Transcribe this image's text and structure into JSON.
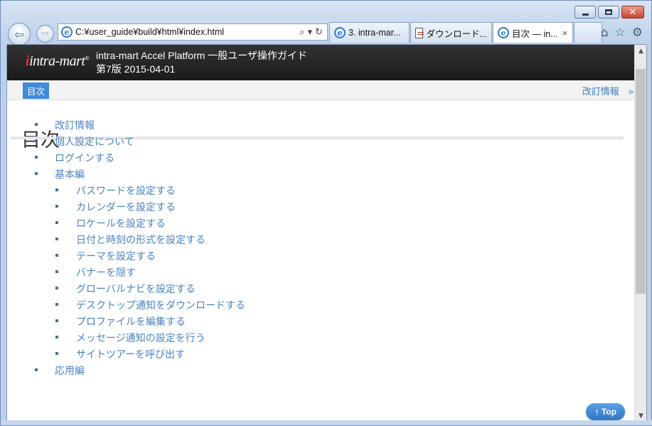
{
  "browser": {
    "address": "C:¥user_guide¥build¥html¥index.html",
    "tabs": [
      {
        "label": "3. intra-mar...",
        "icon": "ie-icon",
        "active": false
      },
      {
        "label": "ダウンロード...",
        "icon": "document-icon",
        "active": false
      },
      {
        "label": "目次 — in...",
        "icon": "ie-icon",
        "active": true
      }
    ],
    "tab_close": "×"
  },
  "site": {
    "logo": "intra-mart",
    "title": "intra-mart Accel Platform 一般ユーザ操作ガイド",
    "edition": "第7版 2015-04-01"
  },
  "crumb": {
    "current": "目次",
    "revision_link": "改訂情報　»"
  },
  "page": {
    "heading": "目次"
  },
  "toc": [
    {
      "label": "改訂情報",
      "level": 1
    },
    {
      "label": "個人設定について",
      "level": 1
    },
    {
      "label": "ログインする",
      "level": 1
    },
    {
      "label": "基本編",
      "level": 1
    },
    {
      "label": "パスワードを設定する",
      "level": 2
    },
    {
      "label": "カレンダーを設定する",
      "level": 2
    },
    {
      "label": "ロケールを設定する",
      "level": 2
    },
    {
      "label": "日付と時刻の形式を設定する",
      "level": 2
    },
    {
      "label": "テーマを設定する",
      "level": 2
    },
    {
      "label": "バナーを隠す",
      "level": 2
    },
    {
      "label": "グローバルナビを設定する",
      "level": 2
    },
    {
      "label": "デスクトップ通知をダウンロードする",
      "level": 2
    },
    {
      "label": "プロファイルを編集する",
      "level": 2
    },
    {
      "label": "メッセージ通知の設定を行う",
      "level": 2
    },
    {
      "label": "サイトツアーを呼び出す",
      "level": 2
    },
    {
      "label": "応用編",
      "level": 1
    }
  ],
  "top_button": "Top"
}
